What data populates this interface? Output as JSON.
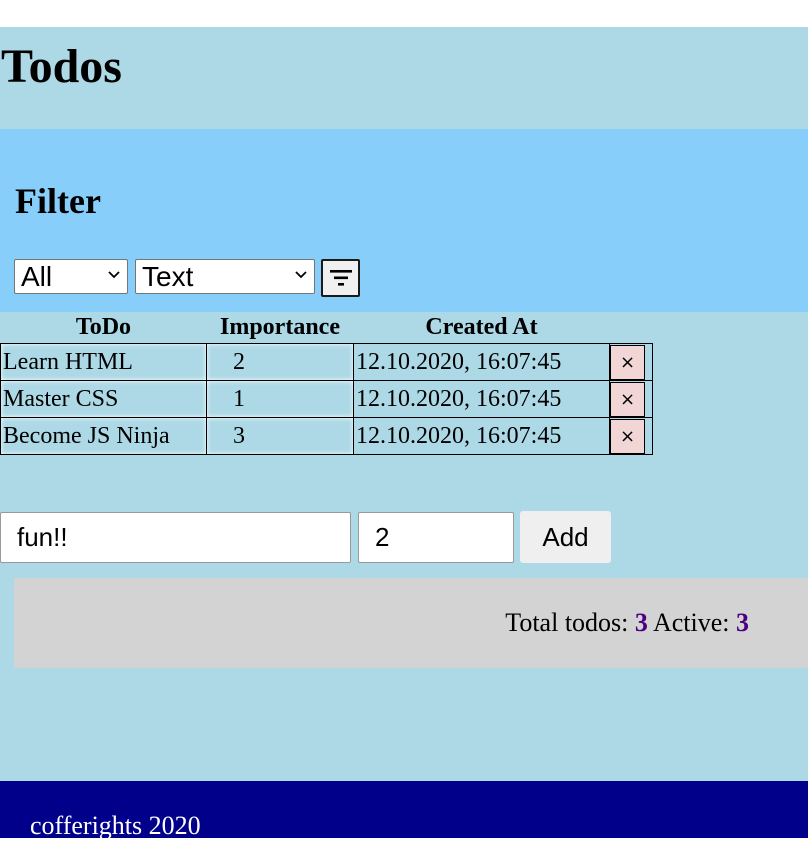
{
  "app": {
    "title": "Todos"
  },
  "filter": {
    "title": "Filter",
    "status_select": {
      "value": "All"
    },
    "sort_select": {
      "value": "Text"
    },
    "filter_button_icon": "filter-icon"
  },
  "table": {
    "headers": [
      "ToDo",
      "Importance",
      "Created At"
    ],
    "rows": [
      {
        "todo": "Learn HTML",
        "importance": "2",
        "created_at": "12.10.2020, 16:07:45",
        "delete_label": "×"
      },
      {
        "todo": "Master CSS",
        "importance": "1",
        "created_at": "12.10.2020, 16:07:45",
        "delete_label": "×"
      },
      {
        "todo": "Become JS Ninja",
        "importance": "3",
        "created_at": "12.10.2020, 16:07:45",
        "delete_label": "×"
      }
    ]
  },
  "new_todo": {
    "text_value": "fun!!",
    "importance_value": "2",
    "add_label": "Add"
  },
  "stats": {
    "total_label": "Total todos:",
    "total_value": "3",
    "active_label": "Active:",
    "active_value": "3"
  },
  "footer": {
    "text": "cofferights 2020"
  },
  "colors": {
    "app_bg": "#add8e6",
    "filter_bg": "#87cefa",
    "stats_bg": "#d3d3d3",
    "stats_number": "#4b0082",
    "footer_bg": "#00008b",
    "delete_button_bg": "#f2d5d5"
  }
}
